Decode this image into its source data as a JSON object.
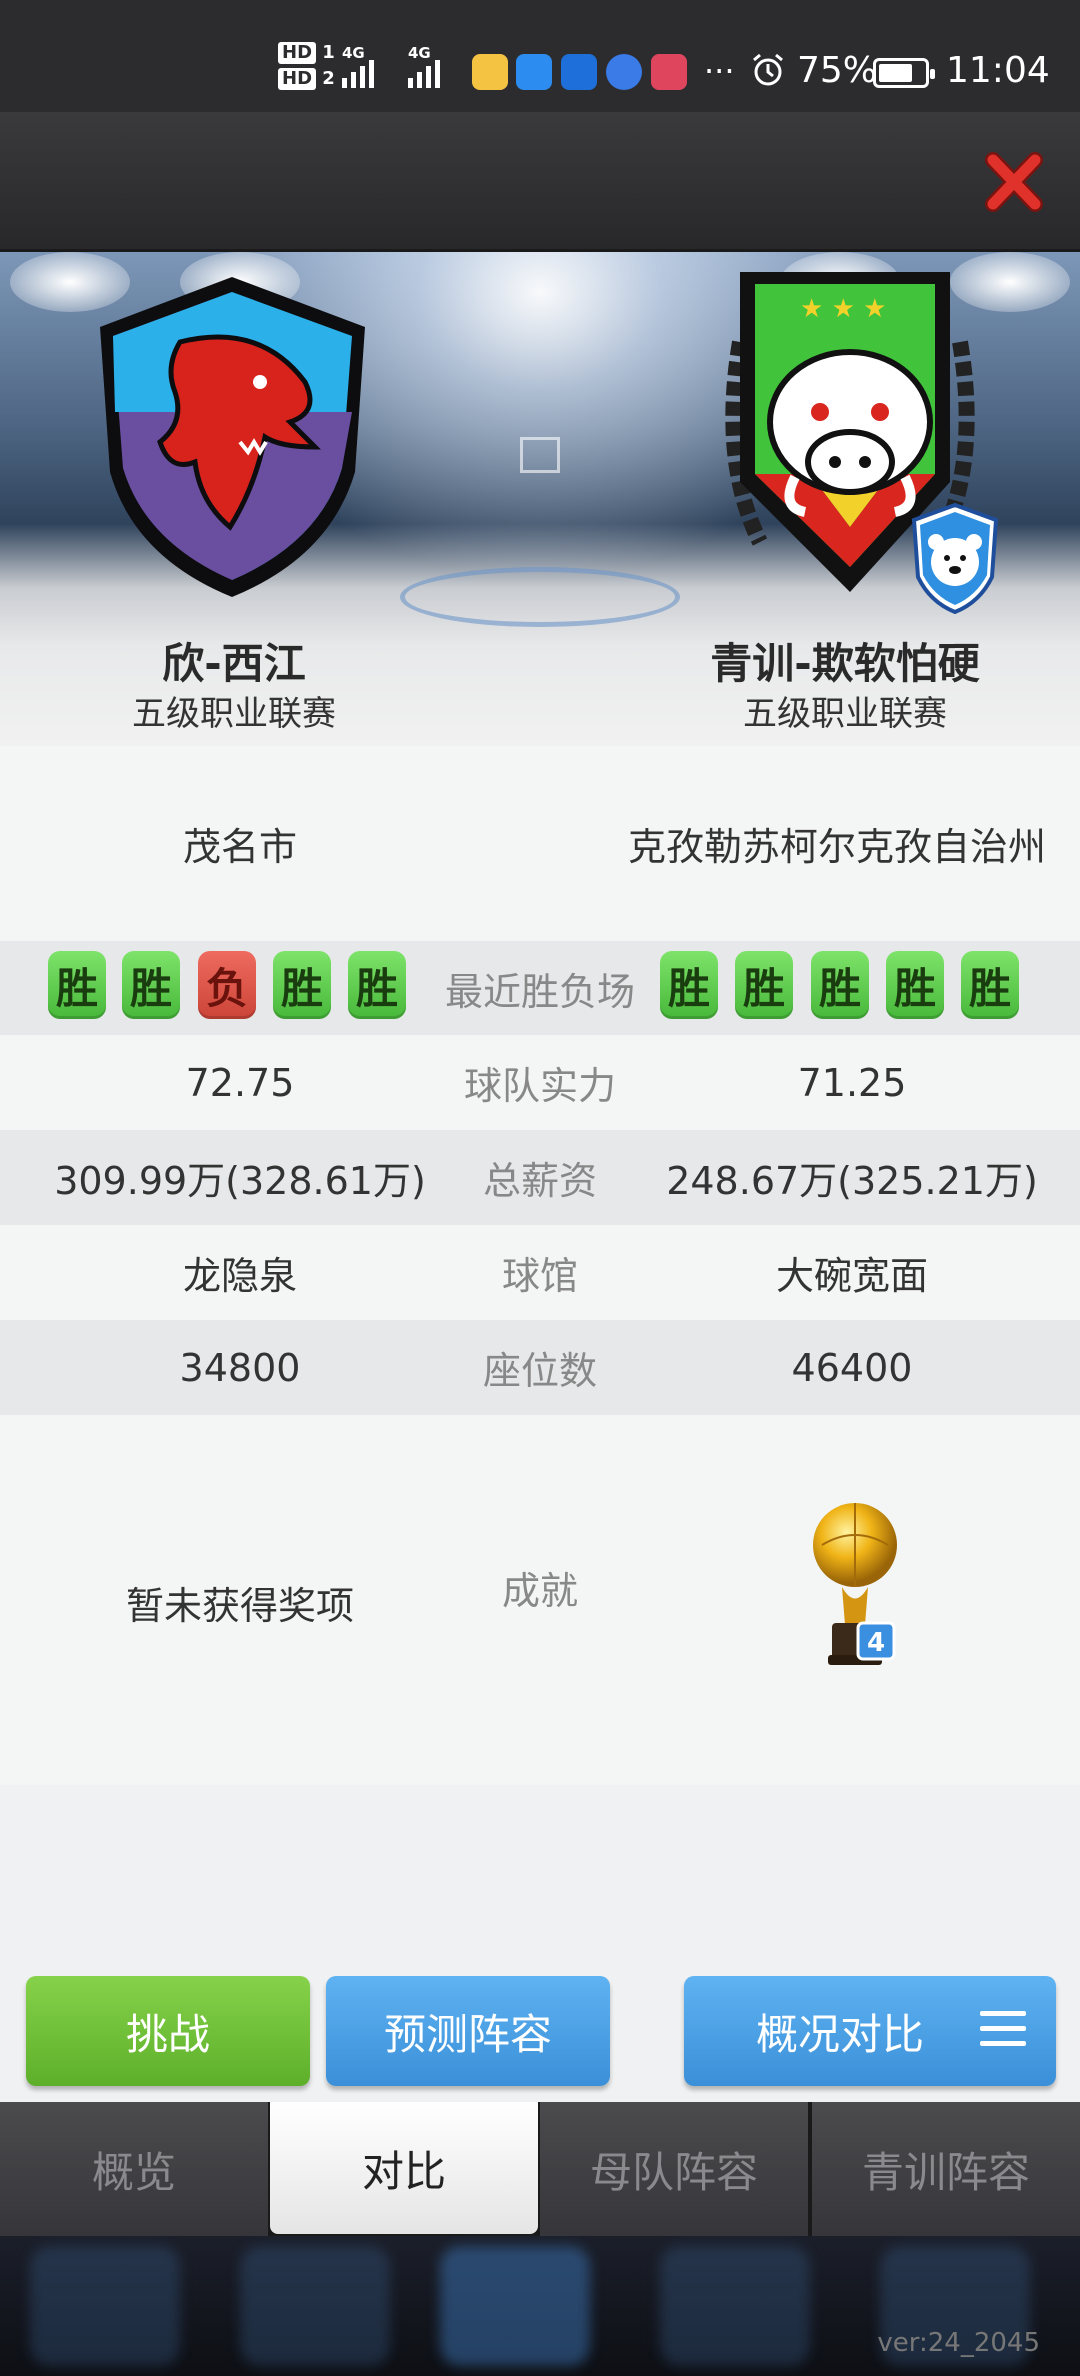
{
  "status_bar": {
    "hd1": "HD",
    "hd1_num": "1",
    "hd2": "HD",
    "hd2_num": "2",
    "net1": "4G",
    "net2": "4G",
    "dots": "···",
    "battery_pct": "75%",
    "battery_level": 0.75,
    "time": "11:04"
  },
  "header": {
    "close_icon": "close-x-icon",
    "close_color": "#e0322b"
  },
  "teams": {
    "left": {
      "name": "欣-西江",
      "league": "五级职业联赛",
      "logo": "red-dragon-shield"
    },
    "right": {
      "name": "青训-欺软怕硬",
      "league": "五级职业联赛",
      "logo": "boar-green-shield"
    }
  },
  "compare": {
    "city": {
      "left": "茂名市",
      "right": "克孜勒苏柯尔克孜自治州"
    },
    "recent": {
      "label": "最近胜负场",
      "left": [
        "胜",
        "胜",
        "负",
        "胜",
        "胜"
      ],
      "right": [
        "胜",
        "胜",
        "胜",
        "胜",
        "胜"
      ]
    },
    "strength": {
      "label": "球队实力",
      "left": "72.75",
      "right": "71.25"
    },
    "salary": {
      "label": "总薪资",
      "left": "309.99万(328.61万)",
      "right": "248.67万(325.21万)"
    },
    "arena": {
      "label": "球馆",
      "left": "龙隐泉",
      "right": "大碗宽面"
    },
    "seats": {
      "label": "座位数",
      "left": "34800",
      "right": "46400"
    },
    "achievements": {
      "label": "成就",
      "left": "暂未获得奖项",
      "right_count": "4"
    }
  },
  "buttons": {
    "challenge": "挑战",
    "predict": "预测阵容",
    "overview": "概况对比"
  },
  "tabs": [
    "概览",
    "对比",
    "母队阵容",
    "青训阵容"
  ],
  "version": "ver:24_2045",
  "colors": {
    "win": "#5cc748",
    "loss": "#dd5548",
    "green_btn": "#6cbd34",
    "blue_btn": "#4aa0e6"
  }
}
